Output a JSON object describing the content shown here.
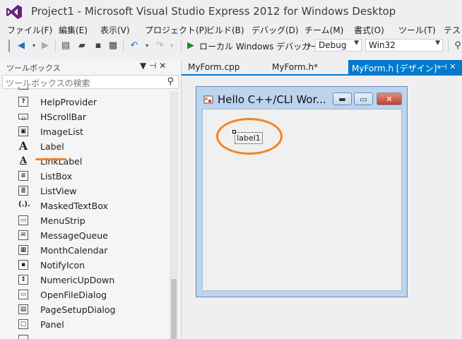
{
  "window": {
    "title": "Project1 - Microsoft Visual Studio Express 2012 for Windows Desktop"
  },
  "menu": [
    "ファイル(F)",
    "編集(E)",
    "表示(V)",
    "プロジェクト(P)",
    "ビルド(B)",
    "デバッグ(D)",
    "チーム(M)",
    "書式(O)",
    "ツール(T)",
    "テスト"
  ],
  "toolbar": {
    "debugger_label": "ローカル Windows デバッガー",
    "configuration": "Debug",
    "platform": "Win32"
  },
  "toolbox": {
    "title": "ツールボックス",
    "pin_glyph": "▼ ⊣ ✕",
    "search_placeholder": "ツールボックスの検索",
    "items": [
      {
        "label": "HelpProvider",
        "icon": "?"
      },
      {
        "label": "HScrollBar",
        "icon": "▫"
      },
      {
        "label": "ImageList",
        "icon": "▣"
      },
      {
        "label": "Label",
        "icon": "A"
      },
      {
        "label": "LinkLabel",
        "icon": "A"
      },
      {
        "label": "ListBox",
        "icon": "≡"
      },
      {
        "label": "ListView",
        "icon": "≣"
      },
      {
        "label": "MaskedTextBox",
        "icon": "(.)."
      },
      {
        "label": "MenuStrip",
        "icon": "▭"
      },
      {
        "label": "MessageQueue",
        "icon": "✉"
      },
      {
        "label": "MonthCalendar",
        "icon": "▦"
      },
      {
        "label": "NotifyIcon",
        "icon": "▪"
      },
      {
        "label": "NumericUpDown",
        "icon": "↕"
      },
      {
        "label": "OpenFileDialog",
        "icon": "▭"
      },
      {
        "label": "PageSetupDialog",
        "icon": "▤"
      },
      {
        "label": "Panel",
        "icon": "▢"
      }
    ]
  },
  "tabs": [
    {
      "label": "MyForm.cpp"
    },
    {
      "label": "MyForm.h*"
    },
    {
      "label": "MyForm.h [デザイン]*",
      "active": true
    }
  ],
  "tab_actions": "⊣ ✕",
  "designer": {
    "form_title": "Hello C++/CLI Wor...",
    "label_text": "label1"
  },
  "colors": {
    "accent": "#007ACC",
    "highlight": "#F58220"
  }
}
